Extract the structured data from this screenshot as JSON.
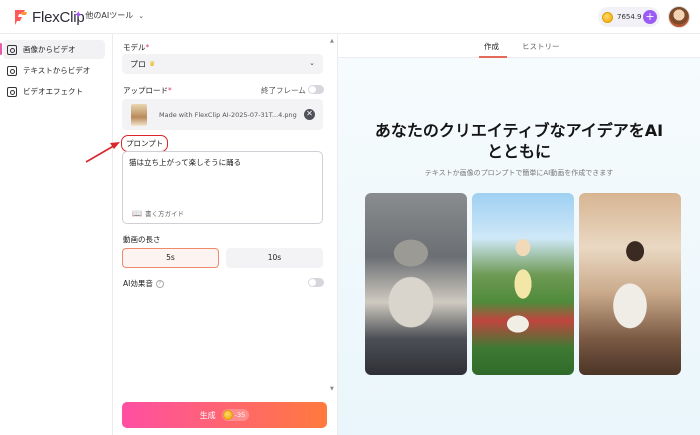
{
  "header": {
    "logo_text": "FlexClip",
    "tools_menu": "他のAIツール",
    "credits": "7654.9",
    "plus": "+"
  },
  "sidebar": {
    "items": [
      {
        "label": "画像からビデオ",
        "active": true
      },
      {
        "label": "テキストからビデオ",
        "active": false
      },
      {
        "label": "ビデオエフェクト",
        "active": false
      }
    ]
  },
  "panel": {
    "model_label": "モデル",
    "model_value": "プロ",
    "upload_label": "アップロード",
    "end_frame_label": "終了フレーム",
    "upload_filename": "Made with FlexClip AI-2025-07-31T...4.png",
    "prompt_label": "プロンプト",
    "prompt_text": "猫は立ち上がって楽しそうに踊る",
    "guide_label": "書く方ガイド",
    "duration_label": "動画の長さ",
    "duration_options": [
      "5s",
      "10s"
    ],
    "selected_duration": "5s",
    "sound_label": "AI効果音",
    "info_icon": "?",
    "generate_label": "生成",
    "generate_cost": "-35"
  },
  "preview": {
    "tabs": [
      "作成",
      "ヒストリー"
    ],
    "active_tab": "作成",
    "headline_line1": "あなたのクリエイティブなアイデアをAI",
    "headline_line2": "とともに",
    "subline": "テキストか画像のプロンプトで簡単にAI動画を作成できます",
    "cards": [
      "cat-photo",
      "girl-with-lamb-photo",
      "woman-reading-photo"
    ]
  },
  "colors": {
    "accent_pink": "#ff4fa3",
    "accent_orange": "#ff7a3d",
    "annotation_red": "#d8262c",
    "purple": "#9b5cf6"
  },
  "icons": [
    "flexclip-logo-icon",
    "sparkle-icon",
    "chevron-down-icon",
    "coin-icon",
    "plus-icon",
    "avatar",
    "image-to-video-icon",
    "text-to-video-icon",
    "video-effect-icon",
    "crown-icon",
    "remove-icon",
    "book-icon",
    "info-icon"
  ]
}
